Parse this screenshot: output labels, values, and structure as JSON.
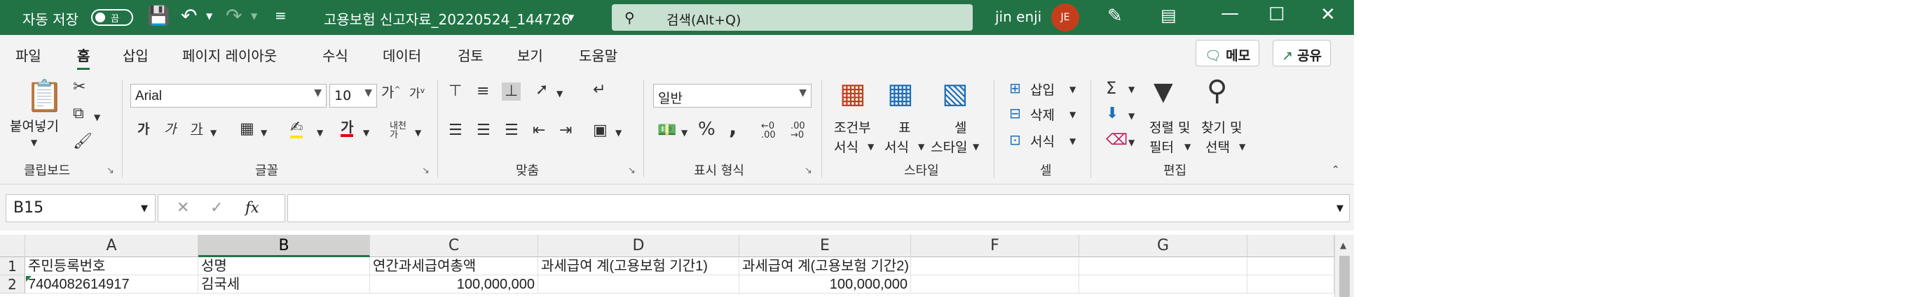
{
  "titlebar": {
    "autosave_label": "자동 저장",
    "autosave_state": "끔",
    "filename": "고용보험 신고자료_20220524_144726",
    "search_placeholder": "검색(Alt+Q)",
    "user_name": "jin enji",
    "user_initials": "JE"
  },
  "menu": {
    "tabs": [
      "파일",
      "홈",
      "삽입",
      "페이지 레이아웃",
      "수식",
      "데이터",
      "검토",
      "보기",
      "도움말"
    ],
    "active": "홈",
    "memo_label": "메모",
    "share_label": "공유"
  },
  "ribbon": {
    "clipboard": {
      "paste_label": "붙여넣기",
      "group_label": "클립보드"
    },
    "font": {
      "font_name": "Arial",
      "font_size": "10",
      "bold": "가",
      "italic": "가",
      "underline": "가",
      "group_label": "글꼴"
    },
    "alignment": {
      "group_label": "맞춤"
    },
    "number": {
      "format": "일반",
      "group_label": "표시 형식"
    },
    "styles": {
      "conditional_line1": "조건부",
      "conditional_line2": "서식",
      "table_line1": "표",
      "table_line2": "서식",
      "cell_line1": "셀",
      "cell_line2": "스타일",
      "group_label": "스타일"
    },
    "cells": {
      "insert": "삽입",
      "delete": "삭제",
      "format": "서식",
      "group_label": "셀"
    },
    "editing": {
      "sort_line1": "정렬 및",
      "sort_line2": "필터",
      "find_line1": "찾기 및",
      "find_line2": "선택",
      "group_label": "편집"
    }
  },
  "formula_bar": {
    "name_box": "B15",
    "formula": ""
  },
  "sheet": {
    "columns": [
      "A",
      "B",
      "C",
      "D",
      "E",
      "F",
      "G"
    ],
    "selected_column": "B",
    "rows": [
      {
        "num": "1",
        "cells": [
          "주민등록번호",
          "성명",
          "연간과세급여총액",
          "과세급여 계(고용보험 기간1)",
          "과세급여 계(고용보험 기간2)",
          "",
          ""
        ]
      },
      {
        "num": "2",
        "cells": [
          "7404082614917",
          "김국세",
          "100,000,000",
          "",
          "100,000,000",
          "",
          ""
        ]
      }
    ]
  },
  "colors": {
    "accent": "#217346",
    "avatar": "#c43e1c"
  }
}
